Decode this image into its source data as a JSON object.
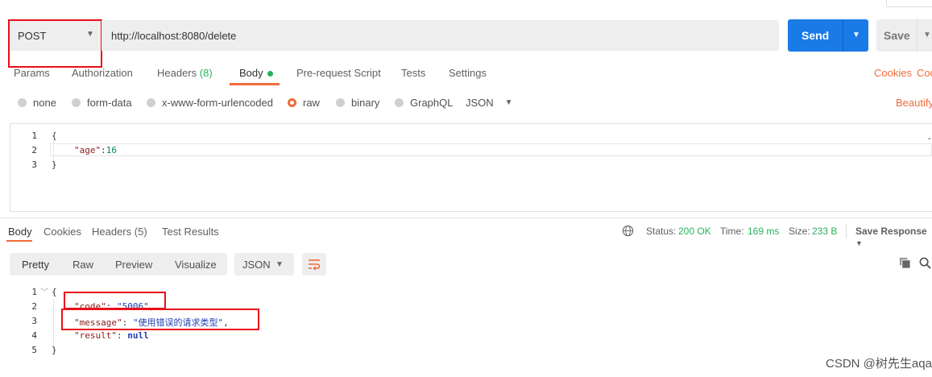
{
  "request": {
    "method": "POST",
    "url": "http://localhost:8080/delete",
    "send_label": "Send",
    "save_label": "Save"
  },
  "request_tabs": [
    {
      "label": "Params"
    },
    {
      "label": "Authorization"
    },
    {
      "label": "Headers",
      "count": "(8)"
    },
    {
      "label": "Body"
    },
    {
      "label": "Pre-request Script"
    },
    {
      "label": "Tests"
    },
    {
      "label": "Settings"
    }
  ],
  "right_links": {
    "cookies": "Cookies",
    "code": "Code",
    "beautify": "Beautify"
  },
  "body_types": [
    {
      "label": "none",
      "selected": false
    },
    {
      "label": "form-data",
      "selected": false
    },
    {
      "label": "x-www-form-urlencoded",
      "selected": false
    },
    {
      "label": "raw",
      "selected": true
    },
    {
      "label": "binary",
      "selected": false
    },
    {
      "label": "GraphQL",
      "selected": false
    }
  ],
  "raw_format": "JSON",
  "request_body": {
    "line_numbers": [
      "1",
      "2",
      "3"
    ],
    "lines": {
      "l1": "{",
      "l2_key": "\"age\"",
      "l2_sep": ":",
      "l2_val": "16",
      "l3": "}"
    }
  },
  "response_tabs": [
    {
      "label": "Body"
    },
    {
      "label": "Cookies"
    },
    {
      "label": "Headers",
      "count": "(5)"
    },
    {
      "label": "Test Results"
    }
  ],
  "response_meta": {
    "status_label": "Status:",
    "status_value": "200 OK",
    "time_label": "Time:",
    "time_value": "169 ms",
    "size_label": "Size:",
    "size_value": "233 B",
    "save_response": "Save Response"
  },
  "view_modes": [
    "Pretty",
    "Raw",
    "Preview",
    "Visualize"
  ],
  "response_format": "JSON",
  "response_body": {
    "line_numbers": [
      "1",
      "2",
      "3",
      "4",
      "5"
    ],
    "lines": {
      "l1": "{",
      "l2_key": "\"code\"",
      "l2_sep": ": ",
      "l2_val": "\"5006\"",
      "l2_end": ",",
      "l3_key": "\"message\"",
      "l3_sep": ": ",
      "l3_val": "\"使用错误的请求类型\"",
      "l3_end": ",",
      "l4_key": "\"result\"",
      "l4_sep": ": ",
      "l4_val": "null",
      "l5": "}"
    }
  },
  "watermark": "CSDN @树先生aqa",
  "colors": {
    "accent": "#f26b3a",
    "send": "#1a7be7",
    "status_ok": "#26b35a",
    "highlight_box": "#e8101b"
  }
}
